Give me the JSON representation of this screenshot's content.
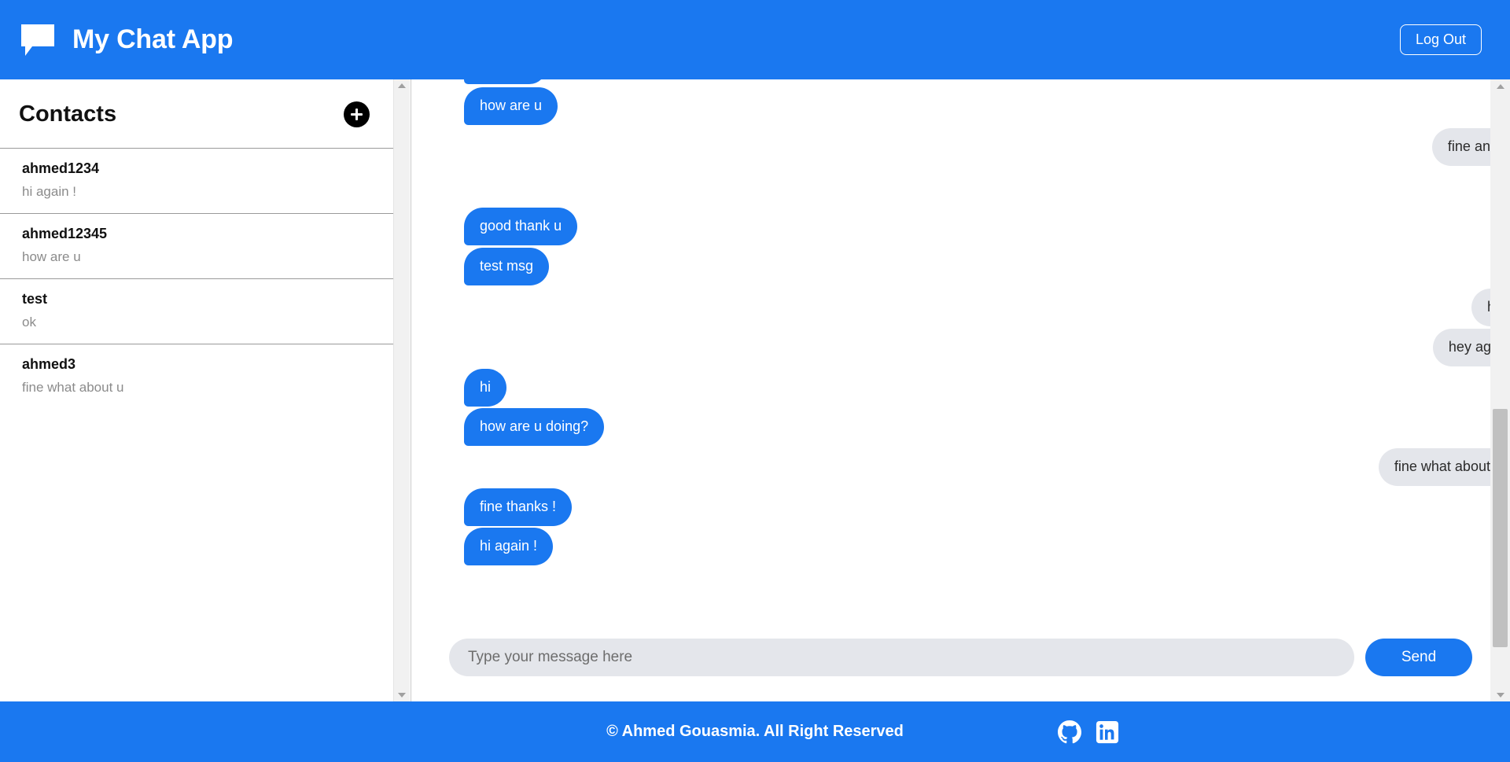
{
  "header": {
    "brand_title": "My Chat App",
    "brand_icon": "chat-bubble-icon",
    "logout_label": "Log Out",
    "background_color": "#1a78f0"
  },
  "sidebar": {
    "title": "Contacts",
    "add_button_icon": "plus-icon",
    "contacts": [
      {
        "name": "ahmed1234",
        "preview": "hi again !"
      },
      {
        "name": "ahmed12345",
        "preview": "how are u"
      },
      {
        "name": "test",
        "preview": "ok"
      },
      {
        "name": "ahmed3",
        "preview": "fine what about u"
      }
    ]
  },
  "chat": {
    "messages": [
      {
        "text": "",
        "side": "left",
        "partial": true
      },
      {
        "text": "how are u",
        "side": "left"
      },
      {
        "text": "fine and u",
        "side": "right"
      },
      {
        "text": "good thank u",
        "side": "left"
      },
      {
        "text": "test msg",
        "side": "left"
      },
      {
        "text": "hey",
        "side": "right"
      },
      {
        "text": "hey again",
        "side": "right"
      },
      {
        "text": "hi",
        "side": "left"
      },
      {
        "text": "how are u doing?",
        "side": "left"
      },
      {
        "text": "fine what about u?",
        "side": "right"
      },
      {
        "text": "fine thanks !",
        "side": "left"
      },
      {
        "text": "hi again !",
        "side": "left"
      }
    ],
    "incoming_color": "#1a78f0",
    "outgoing_color": "#e4e6eb"
  },
  "composer": {
    "input_value": "",
    "input_placeholder": "Type your message here",
    "send_label": "Send"
  },
  "footer": {
    "copyright": "© Ahmed Gouasmia. All Right Reserved",
    "socials": [
      {
        "icon": "github-icon"
      },
      {
        "icon": "linkedin-icon"
      }
    ]
  }
}
